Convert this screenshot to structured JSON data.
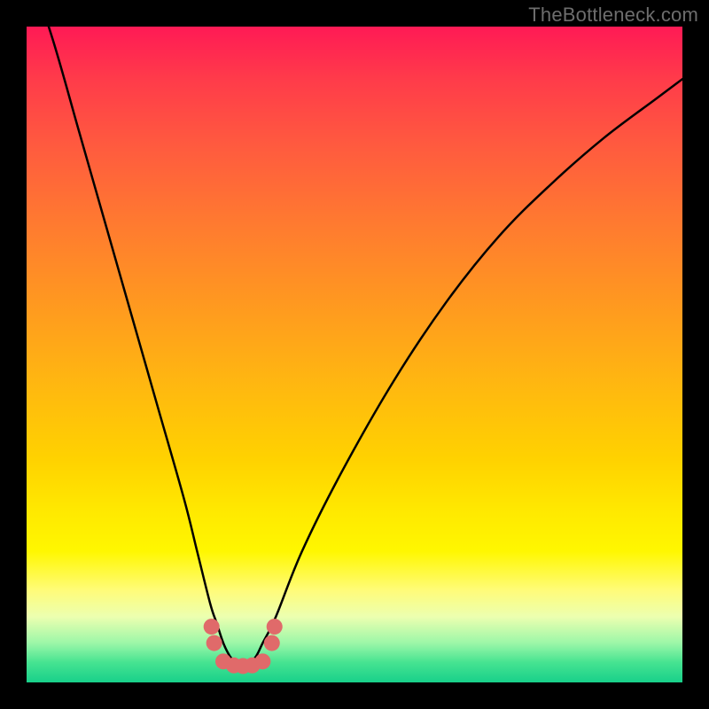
{
  "watermark": "TheBottleneck.com",
  "chart_data": {
    "type": "line",
    "title": "",
    "xlabel": "",
    "ylabel": "",
    "xlim": [
      0,
      100
    ],
    "ylim": [
      0,
      100
    ],
    "grid": false,
    "series": [
      {
        "name": "bottleneck-curve",
        "x": [
          0,
          4,
          8,
          12,
          16,
          20,
          24,
          26,
          28,
          29,
          30,
          31,
          32,
          33,
          34,
          35,
          36,
          38,
          42,
          48,
          56,
          64,
          72,
          80,
          88,
          96,
          100
        ],
        "y": [
          110,
          98,
          84,
          70,
          56,
          42,
          28,
          20,
          12,
          9,
          6,
          4,
          3,
          3,
          3,
          4,
          6,
          10,
          20,
          32,
          46,
          58,
          68,
          76,
          83,
          89,
          92
        ]
      }
    ],
    "markers": {
      "name": "data-points",
      "x": [
        28.2,
        28.6,
        30.0,
        31.6,
        33.0,
        34.4,
        36.0,
        37.4,
        37.8
      ],
      "y": [
        8.5,
        6.0,
        3.2,
        2.6,
        2.5,
        2.6,
        3.2,
        6.0,
        8.5
      ]
    },
    "background_gradient": {
      "top": "#ff1a55",
      "mid_high": "#ff9820",
      "mid": "#ffe900",
      "mid_low": "#ecffb0",
      "bottom": "#18d08a"
    }
  }
}
